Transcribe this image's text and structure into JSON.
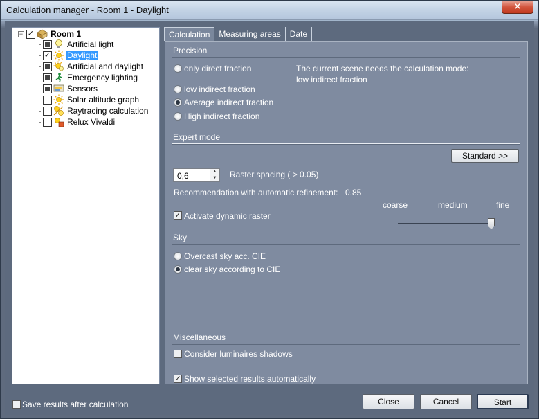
{
  "window": {
    "title": "Calculation manager - Room 1 - Daylight",
    "close_glyph": "✕"
  },
  "tree": {
    "root": {
      "label": "Room 1",
      "checked": true,
      "expander": "−"
    },
    "items": [
      {
        "label": "Artificial light",
        "state": "indeterminate",
        "icon": "bulb-icon",
        "selected": false
      },
      {
        "label": "Daylight",
        "state": "checked",
        "icon": "sun-icon",
        "selected": true
      },
      {
        "label": "Artificial and daylight",
        "state": "indeterminate",
        "icon": "sun-bulb-icon",
        "selected": false
      },
      {
        "label": "Emergency lighting",
        "state": "indeterminate",
        "icon": "emergency-exit-icon",
        "selected": false
      },
      {
        "label": "Sensors",
        "state": "indeterminate",
        "icon": "sensor-icon",
        "selected": false
      },
      {
        "label": "Solar altitude graph",
        "state": "unchecked",
        "icon": "sun-icon",
        "selected": false
      },
      {
        "label": "Raytracing calculation",
        "state": "unchecked",
        "icon": "raytrace-icon",
        "selected": false
      },
      {
        "label": "Relux Vivaldi",
        "state": "unchecked",
        "icon": "vivaldi-icon",
        "selected": false
      }
    ]
  },
  "tabs": [
    {
      "label": "Calculation",
      "active": true
    },
    {
      "label": "Measuring areas",
      "active": false
    },
    {
      "label": "Date",
      "active": false
    }
  ],
  "precision": {
    "heading": "Precision",
    "options": [
      {
        "label": "only direct fraction",
        "selected": false
      },
      {
        "label": "low indirect fraction",
        "selected": false
      },
      {
        "label": "Average indirect fraction",
        "selected": true
      },
      {
        "label": "High indirect fraction",
        "selected": false
      }
    ],
    "note_line1": "The current scene needs the calculation mode:",
    "note_line2": "low indirect fraction"
  },
  "expert": {
    "heading": "Expert mode",
    "standard_button": "Standard >>",
    "raster_value": "0,6",
    "raster_label": "Raster spacing ( > 0.05)",
    "recommendation_label": "Recommendation with automatic refinement:",
    "recommendation_value": "0.85",
    "dynamic_raster_label": "Activate dynamic raster",
    "dynamic_raster_checked": true,
    "slider_labels": {
      "coarse": "coarse",
      "medium": "medium",
      "fine": "fine"
    },
    "slider_position": "fine"
  },
  "sky": {
    "heading": "Sky",
    "options": [
      {
        "label": "Overcast sky acc. CIE",
        "selected": false
      },
      {
        "label": "clear sky according to CIE",
        "selected": true
      }
    ]
  },
  "misc": {
    "heading": "Miscellaneous",
    "luminaire_shadows_label": "Consider luminaires shadows",
    "luminaire_shadows_checked": false,
    "show_results_label": "Show selected results automatically",
    "show_results_checked": true
  },
  "footer": {
    "save_results_label": "Save results after calculation",
    "save_results_checked": false,
    "close_button": "Close",
    "cancel_button": "Cancel",
    "start_button": "Start"
  },
  "glyphs": {
    "check": "✓",
    "spin_up": "▲",
    "spin_down": "▼"
  }
}
